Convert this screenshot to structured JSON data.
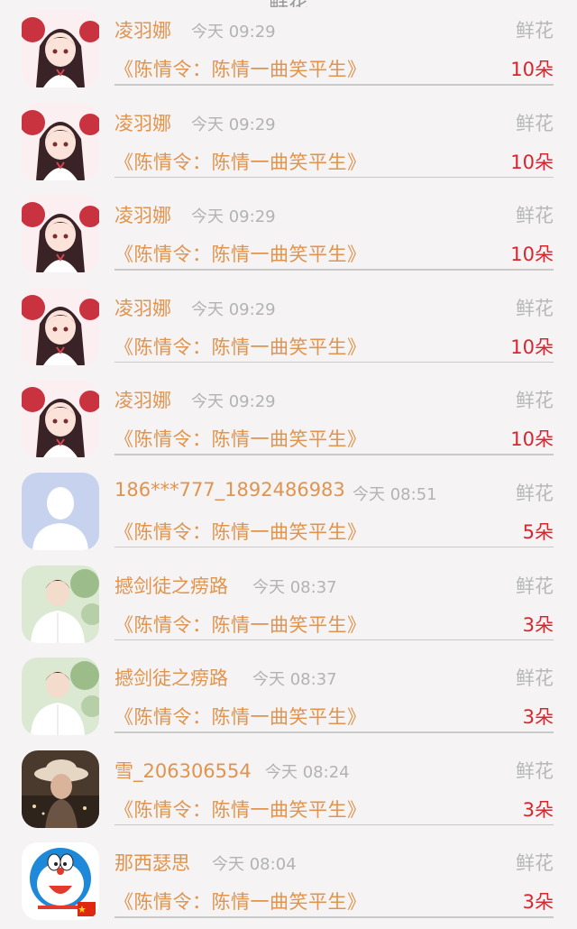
{
  "header": {
    "title": "鲜花"
  },
  "gift_label": "鲜花",
  "book_title": "《陈情令：陈情一曲笑平生》",
  "entries": [
    {
      "name": "凌羽娜",
      "time": "今天 09:29",
      "count": "10朵",
      "avatar": "anime-girl-avatar"
    },
    {
      "name": "凌羽娜",
      "time": "今天 09:29",
      "count": "10朵",
      "avatar": "anime-girl-avatar"
    },
    {
      "name": "凌羽娜",
      "time": "今天 09:29",
      "count": "10朵",
      "avatar": "anime-girl-avatar"
    },
    {
      "name": "凌羽娜",
      "time": "今天 09:29",
      "count": "10朵",
      "avatar": "anime-girl-avatar"
    },
    {
      "name": "凌羽娜",
      "time": "今天 09:29",
      "count": "10朵",
      "avatar": "anime-girl-avatar"
    },
    {
      "name": "186***777_1892486983",
      "time": "今天 08:51",
      "count": "5朵",
      "avatar": "default-person-avatar"
    },
    {
      "name": "撼剑徒之痨路",
      "time": "今天 08:37",
      "count": "3朵",
      "avatar": "young-man-photo-avatar"
    },
    {
      "name": "撼剑徒之痨路",
      "time": "今天 08:37",
      "count": "3朵",
      "avatar": "young-man-photo-avatar"
    },
    {
      "name": "雪_206306554",
      "time": "今天 08:24",
      "count": "3朵",
      "avatar": "girl-with-hat-photo-avatar"
    },
    {
      "name": "那西瑟思",
      "time": "今天 08:04",
      "count": "3朵",
      "avatar": "doraemon-avatar"
    }
  ],
  "colors": {
    "name": "#e0944e",
    "count": "#d9252d",
    "secondary": "#b3b3b3"
  }
}
